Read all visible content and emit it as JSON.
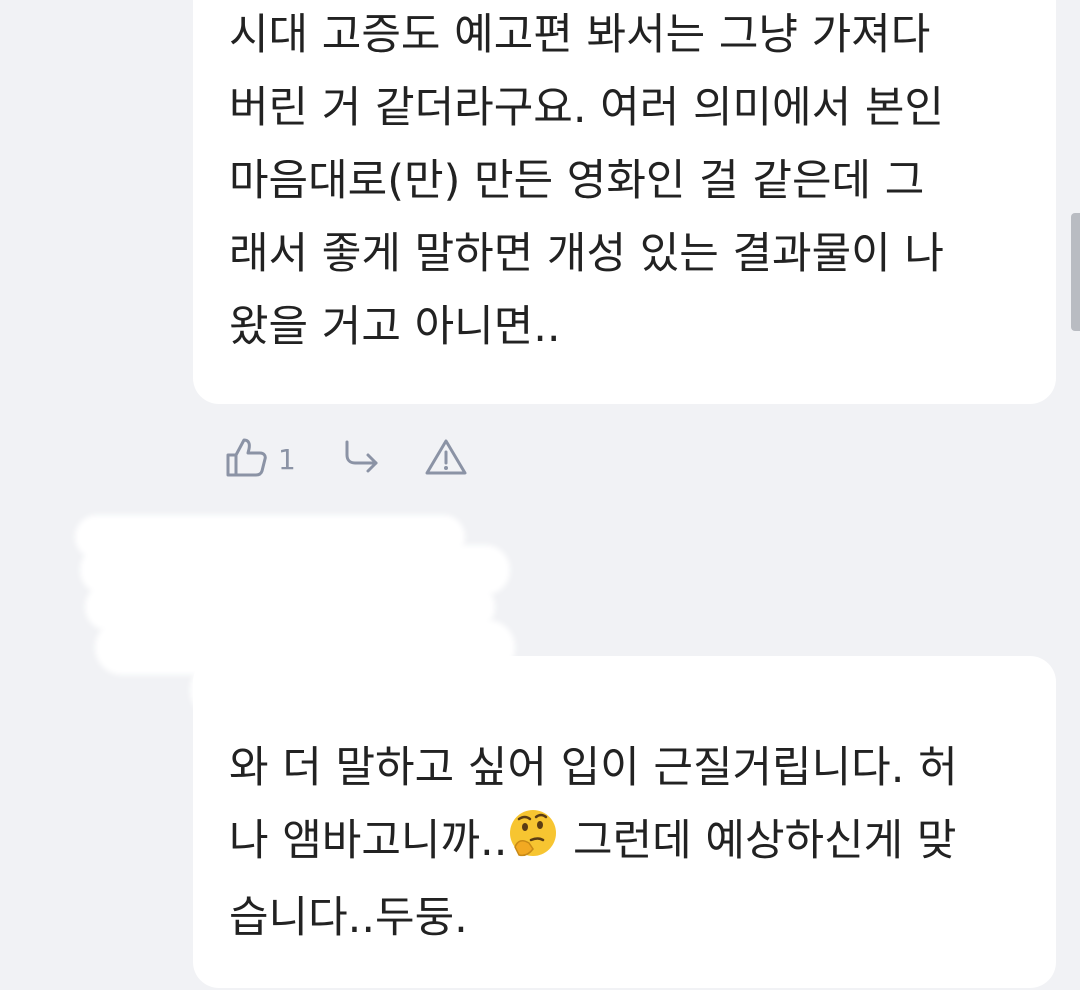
{
  "comments": [
    {
      "text": "시대 고증도 예고편 봐서는 그냥 가져다\n버린 거 같더라구요. 여러 의미에서 본인\n마음대로(만) 만든 영화인 걸 같은데 그\n래서 좋게 말하면 개성 있는 결과물이 나\n왔을 거고 아니면.."
    },
    {
      "text_part1": "와 더 말하고 싶어 입이 근질거립니다. 허\n나 앰바고니까..",
      "emoji": "thinking-face",
      "text_part2": " 그런데 예상하신게 맞\n습니다..두둥."
    }
  ],
  "actions": {
    "like_icon": "thumbs-up-icon",
    "like_count": "1",
    "reply_icon": "reply-arrow-icon",
    "report_icon": "warning-triangle-icon"
  },
  "colors": {
    "background": "#f1f2f5",
    "bubble": "#ffffff",
    "text": "#222222",
    "icon": "#8b93a5"
  }
}
